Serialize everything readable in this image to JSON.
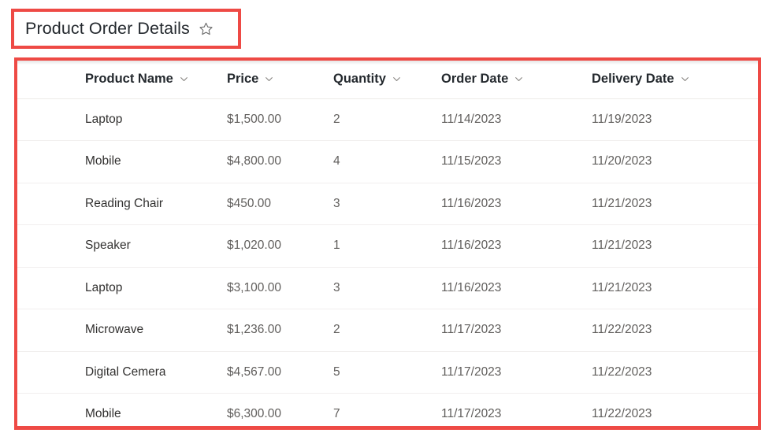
{
  "header": {
    "title": "Product Order Details",
    "favorite_icon": "star-icon"
  },
  "table": {
    "columns": [
      {
        "label": "Product Name",
        "key": "product_name",
        "sort_icon": "chevron-down-icon"
      },
      {
        "label": "Price",
        "key": "price",
        "sort_icon": "chevron-down-icon"
      },
      {
        "label": "Quantity",
        "key": "quantity",
        "sort_icon": "chevron-down-icon"
      },
      {
        "label": "Order Date",
        "key": "order_date",
        "sort_icon": "chevron-down-icon"
      },
      {
        "label": "Delivery Date",
        "key": "delivery_date",
        "sort_icon": "chevron-down-icon"
      }
    ],
    "rows": [
      {
        "product_name": "Laptop",
        "price": "$1,500.00",
        "quantity": "2",
        "order_date": "11/14/2023",
        "delivery_date": "11/19/2023"
      },
      {
        "product_name": "Mobile",
        "price": "$4,800.00",
        "quantity": "4",
        "order_date": "11/15/2023",
        "delivery_date": "11/20/2023"
      },
      {
        "product_name": "Reading Chair",
        "price": "$450.00",
        "quantity": "3",
        "order_date": "11/16/2023",
        "delivery_date": "11/21/2023"
      },
      {
        "product_name": "Speaker",
        "price": "$1,020.00",
        "quantity": "1",
        "order_date": "11/16/2023",
        "delivery_date": "11/21/2023"
      },
      {
        "product_name": "Laptop",
        "price": "$3,100.00",
        "quantity": "3",
        "order_date": "11/16/2023",
        "delivery_date": "11/21/2023"
      },
      {
        "product_name": "Microwave",
        "price": "$1,236.00",
        "quantity": "2",
        "order_date": "11/17/2023",
        "delivery_date": "11/22/2023"
      },
      {
        "product_name": "Digital Cemera",
        "price": "$4,567.00",
        "quantity": "5",
        "order_date": "11/17/2023",
        "delivery_date": "11/22/2023"
      },
      {
        "product_name": "Mobile",
        "price": "$6,300.00",
        "quantity": "7",
        "order_date": "11/17/2023",
        "delivery_date": "11/22/2023"
      }
    ]
  },
  "annotations": {
    "color": "#ee4a45",
    "boxes": [
      {
        "name": "title-highlight"
      },
      {
        "name": "table-highlight"
      }
    ]
  }
}
